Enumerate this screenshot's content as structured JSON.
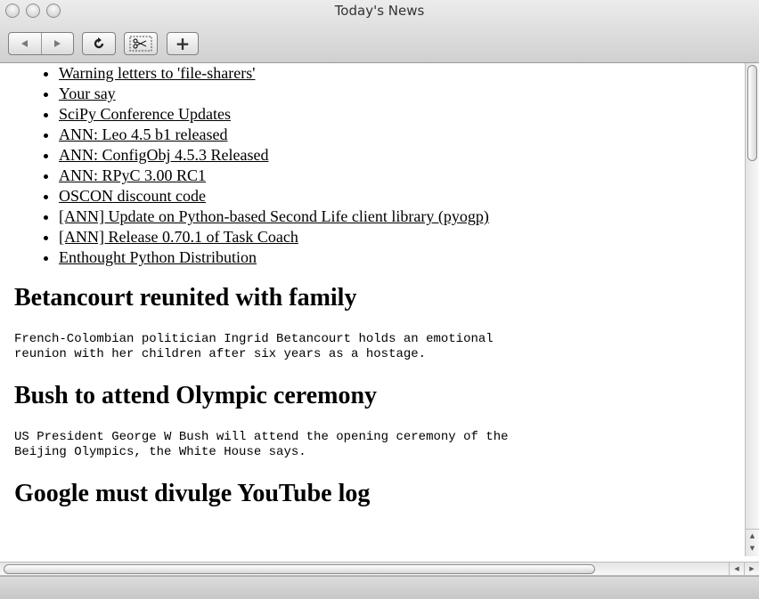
{
  "window": {
    "title": "Today's News"
  },
  "toolbar": {
    "back_icon": "back-arrow-icon",
    "forward_icon": "forward-arrow-icon",
    "reload_icon": "reload-icon",
    "clip_icon": "scissors-clip-icon",
    "add_label": "+"
  },
  "links": [
    "Warning letters to 'file-sharers'",
    "Your say",
    "SciPy Conference Updates",
    "ANN: Leo 4.5 b1 released",
    "ANN: ConfigObj 4.5.3 Released",
    "ANN: RPyC 3.00 RC1",
    "OSCON discount code",
    "[ANN] Update on Python-based Second Life client library (pyogp)",
    "[ANN] Release 0.70.1 of Task Coach",
    "Enthought Python Distribution"
  ],
  "stories": [
    {
      "title": "Betancourt reunited with family",
      "body": "French-Colombian politician Ingrid Betancourt holds an emotional\nreunion with her children after six years as a hostage."
    },
    {
      "title": "Bush to attend Olympic ceremony",
      "body": "US President George W Bush will attend the opening ceremony of the\nBeijing Olympics, the White House says."
    },
    {
      "title": "Google must divulge YouTube log",
      "body": ""
    }
  ]
}
